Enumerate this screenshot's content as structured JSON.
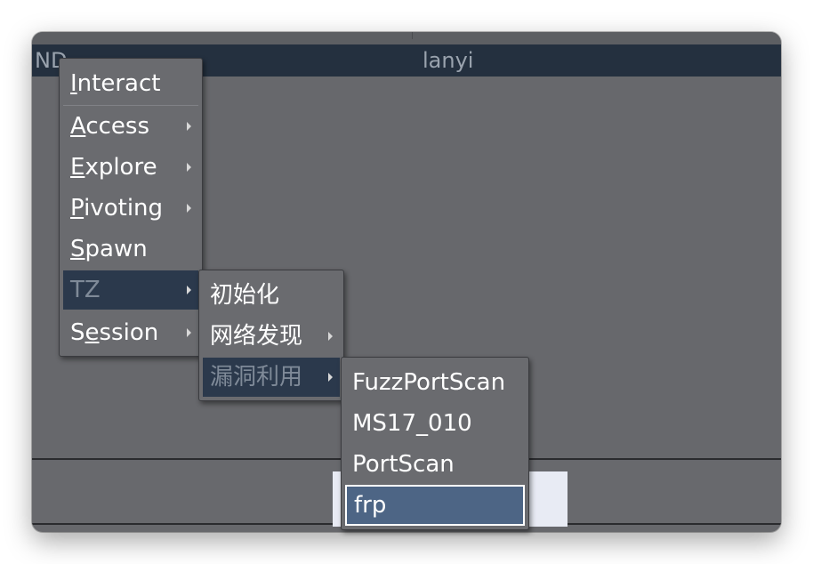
{
  "header": {
    "left_text": "ND",
    "title": "lanyi"
  },
  "menu_main": {
    "items": [
      {
        "key": "I",
        "rest": "nteract"
      },
      {
        "key": "A",
        "rest": "ccess"
      },
      {
        "key": "E",
        "rest": "xplore"
      },
      {
        "key": "P",
        "rest": "ivoting"
      },
      {
        "key": "S",
        "rest": "pawn"
      },
      {
        "label": "TZ"
      },
      {
        "pre": "S",
        "key": "e",
        "rest": "ssion"
      }
    ]
  },
  "menu_tz": {
    "items": [
      "初始化",
      "网络发现",
      "漏洞利用"
    ]
  },
  "menu_exploit": {
    "items": [
      "FuzzPortScan",
      "MS17_010",
      "PortScan",
      "frp"
    ]
  },
  "colors": {
    "header_bg": "#24303f",
    "active_bg": "#2b394c",
    "selected_bg": "#4d6585",
    "menu_bg": "#6a6b6f"
  }
}
